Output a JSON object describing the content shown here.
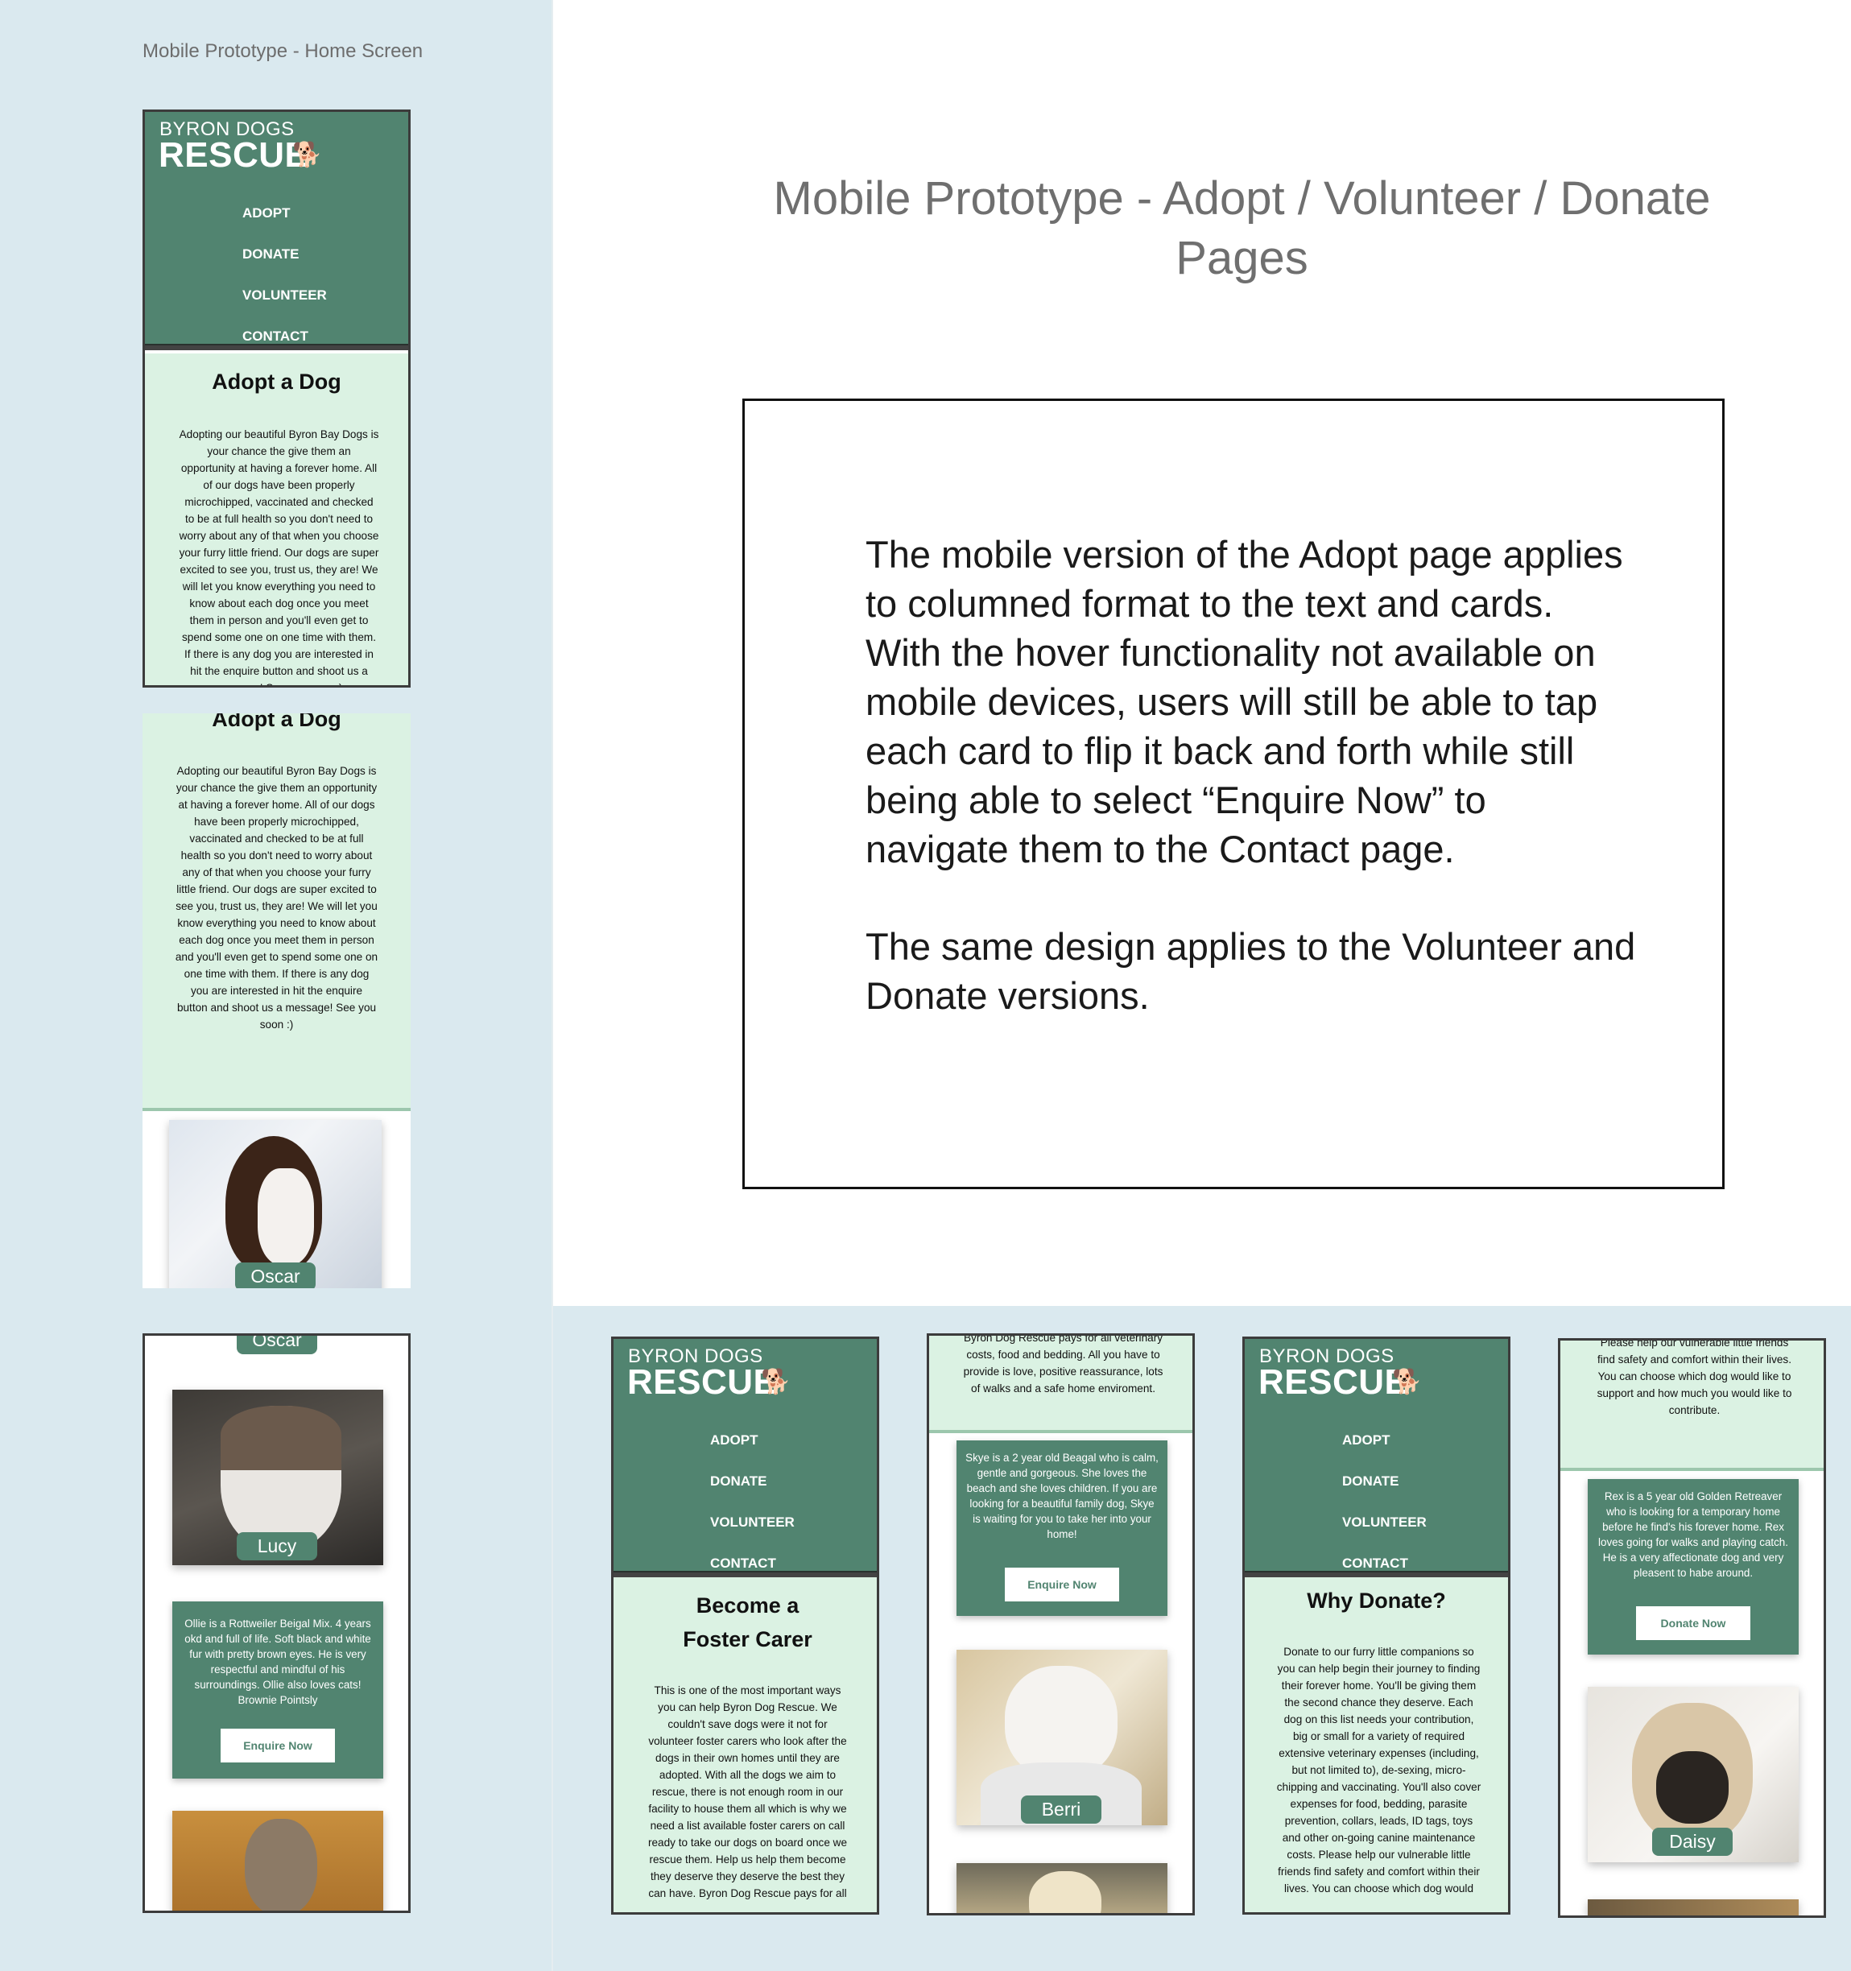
{
  "home_label": "Mobile Prototype - Home Screen",
  "page_title": "Mobile Prototype - Adopt / Volunteer / Donate Pages",
  "description": {
    "p1": "The mobile version of the Adopt page applies to columned format to the text and cards. With the hover functionality not available on mobile devices, users will still be able to tap each card to flip it back and forth while still being able to select “Enquire Now” to navigate them to the Contact page.",
    "p2": "The same design applies to the Volunteer and Donate versions."
  },
  "brand": {
    "line1": "BYRON DOGS",
    "line2": "RESCUE",
    "icon": "dog-icon"
  },
  "nav": [
    "ADOPT",
    "DONATE",
    "VOLUNTEER",
    "CONTACT"
  ],
  "adopt": {
    "heading": "Adopt a Dog",
    "body": "Adopting our beautiful Byron Bay Dogs is your chance the give them an opportunity at having a forever home. All of our dogs have been properly microchipped, vaccinated and checked to be at full health so you don't need to worry about any of that when you choose your furry little friend. Our dogs are super excited to see you, trust us, they are! We will let you know everything you need to know about each dog once you meet them in person and you'll even get to spend some one on one time with them. If there is any dog you are interested in hit the enquire button and shoot us a message! See you soon :)"
  },
  "dogs": {
    "oscar": "Oscar",
    "lucy": "Lucy",
    "berri": "Berri",
    "daisy": "Daisy"
  },
  "ollie_card": {
    "text": "Ollie is a Rottweiler Beigal Mix. 4 years okd and full of life. Soft black and white fur with pretty brown eyes. He is very respectful and mindful of his surroundings. Ollie also loves cats! Brownie Pointsly",
    "button": "Enquire Now"
  },
  "foster": {
    "heading": "Become a Foster Carer",
    "body": "This is one of the most important ways you can help Byron Dog Rescue. We couldn't save dogs were it not for volunteer foster carers who look after the dogs in their own homes until they are adopted. With all the dogs we aim to rescue, there is not enough room in our facility to house them all which is why we need a list available foster carers on call ready to take our dogs on board once we rescue them. Help us help them become they deserve they deserve the best they can have. Byron Dog Rescue pays for all",
    "body_cont": "Byron Dog Rescue pays for all veterinary costs, food and bedding. All you have to provide is love, positive reassurance, lots of walks and a safe home enviroment."
  },
  "skye_card": {
    "text": "Skye is a 2 year old Beagal who is calm, gentle and gorgeous. She loves the beach and she loves children. If you are looking for a beautiful family dog, Skye is waiting for you to take her into your home!",
    "button": "Enquire Now"
  },
  "donate": {
    "heading": "Why Donate?",
    "body": "Donate to our furry little companions so you can help begin their journey to finding their forever home. You'll be giving them the second chance they deserve. Each dog on this list needs your contribution, big or small for a variety of required extensive veterinary expenses (including, but not limited to), de-sexing, micro-chipping and vaccinating. You'll also cover expenses for food, bedding, parasite prevention, collars, leads, ID tags, toys and other on-going canine maintenance costs. Please help our vulnerable little friends find safety and comfort within their lives. You can choose which dog would",
    "body_cont": "Please help our vulnerable little friends find safety and comfort within their lives. You can choose which dog would like to support and how much you would like to contribute."
  },
  "rex_card": {
    "text": "Rex is a 5 year old Golden Retreaver who is looking for a temporary home before he find's his forever home. Rex loves going for walks and playing catch. He is a very affectionate dog and very pleasent to habe around.",
    "button": "Donate Now"
  },
  "colors": {
    "green": "#518470",
    "mint": "#dbf2e3",
    "panel": "#dae9ef"
  }
}
